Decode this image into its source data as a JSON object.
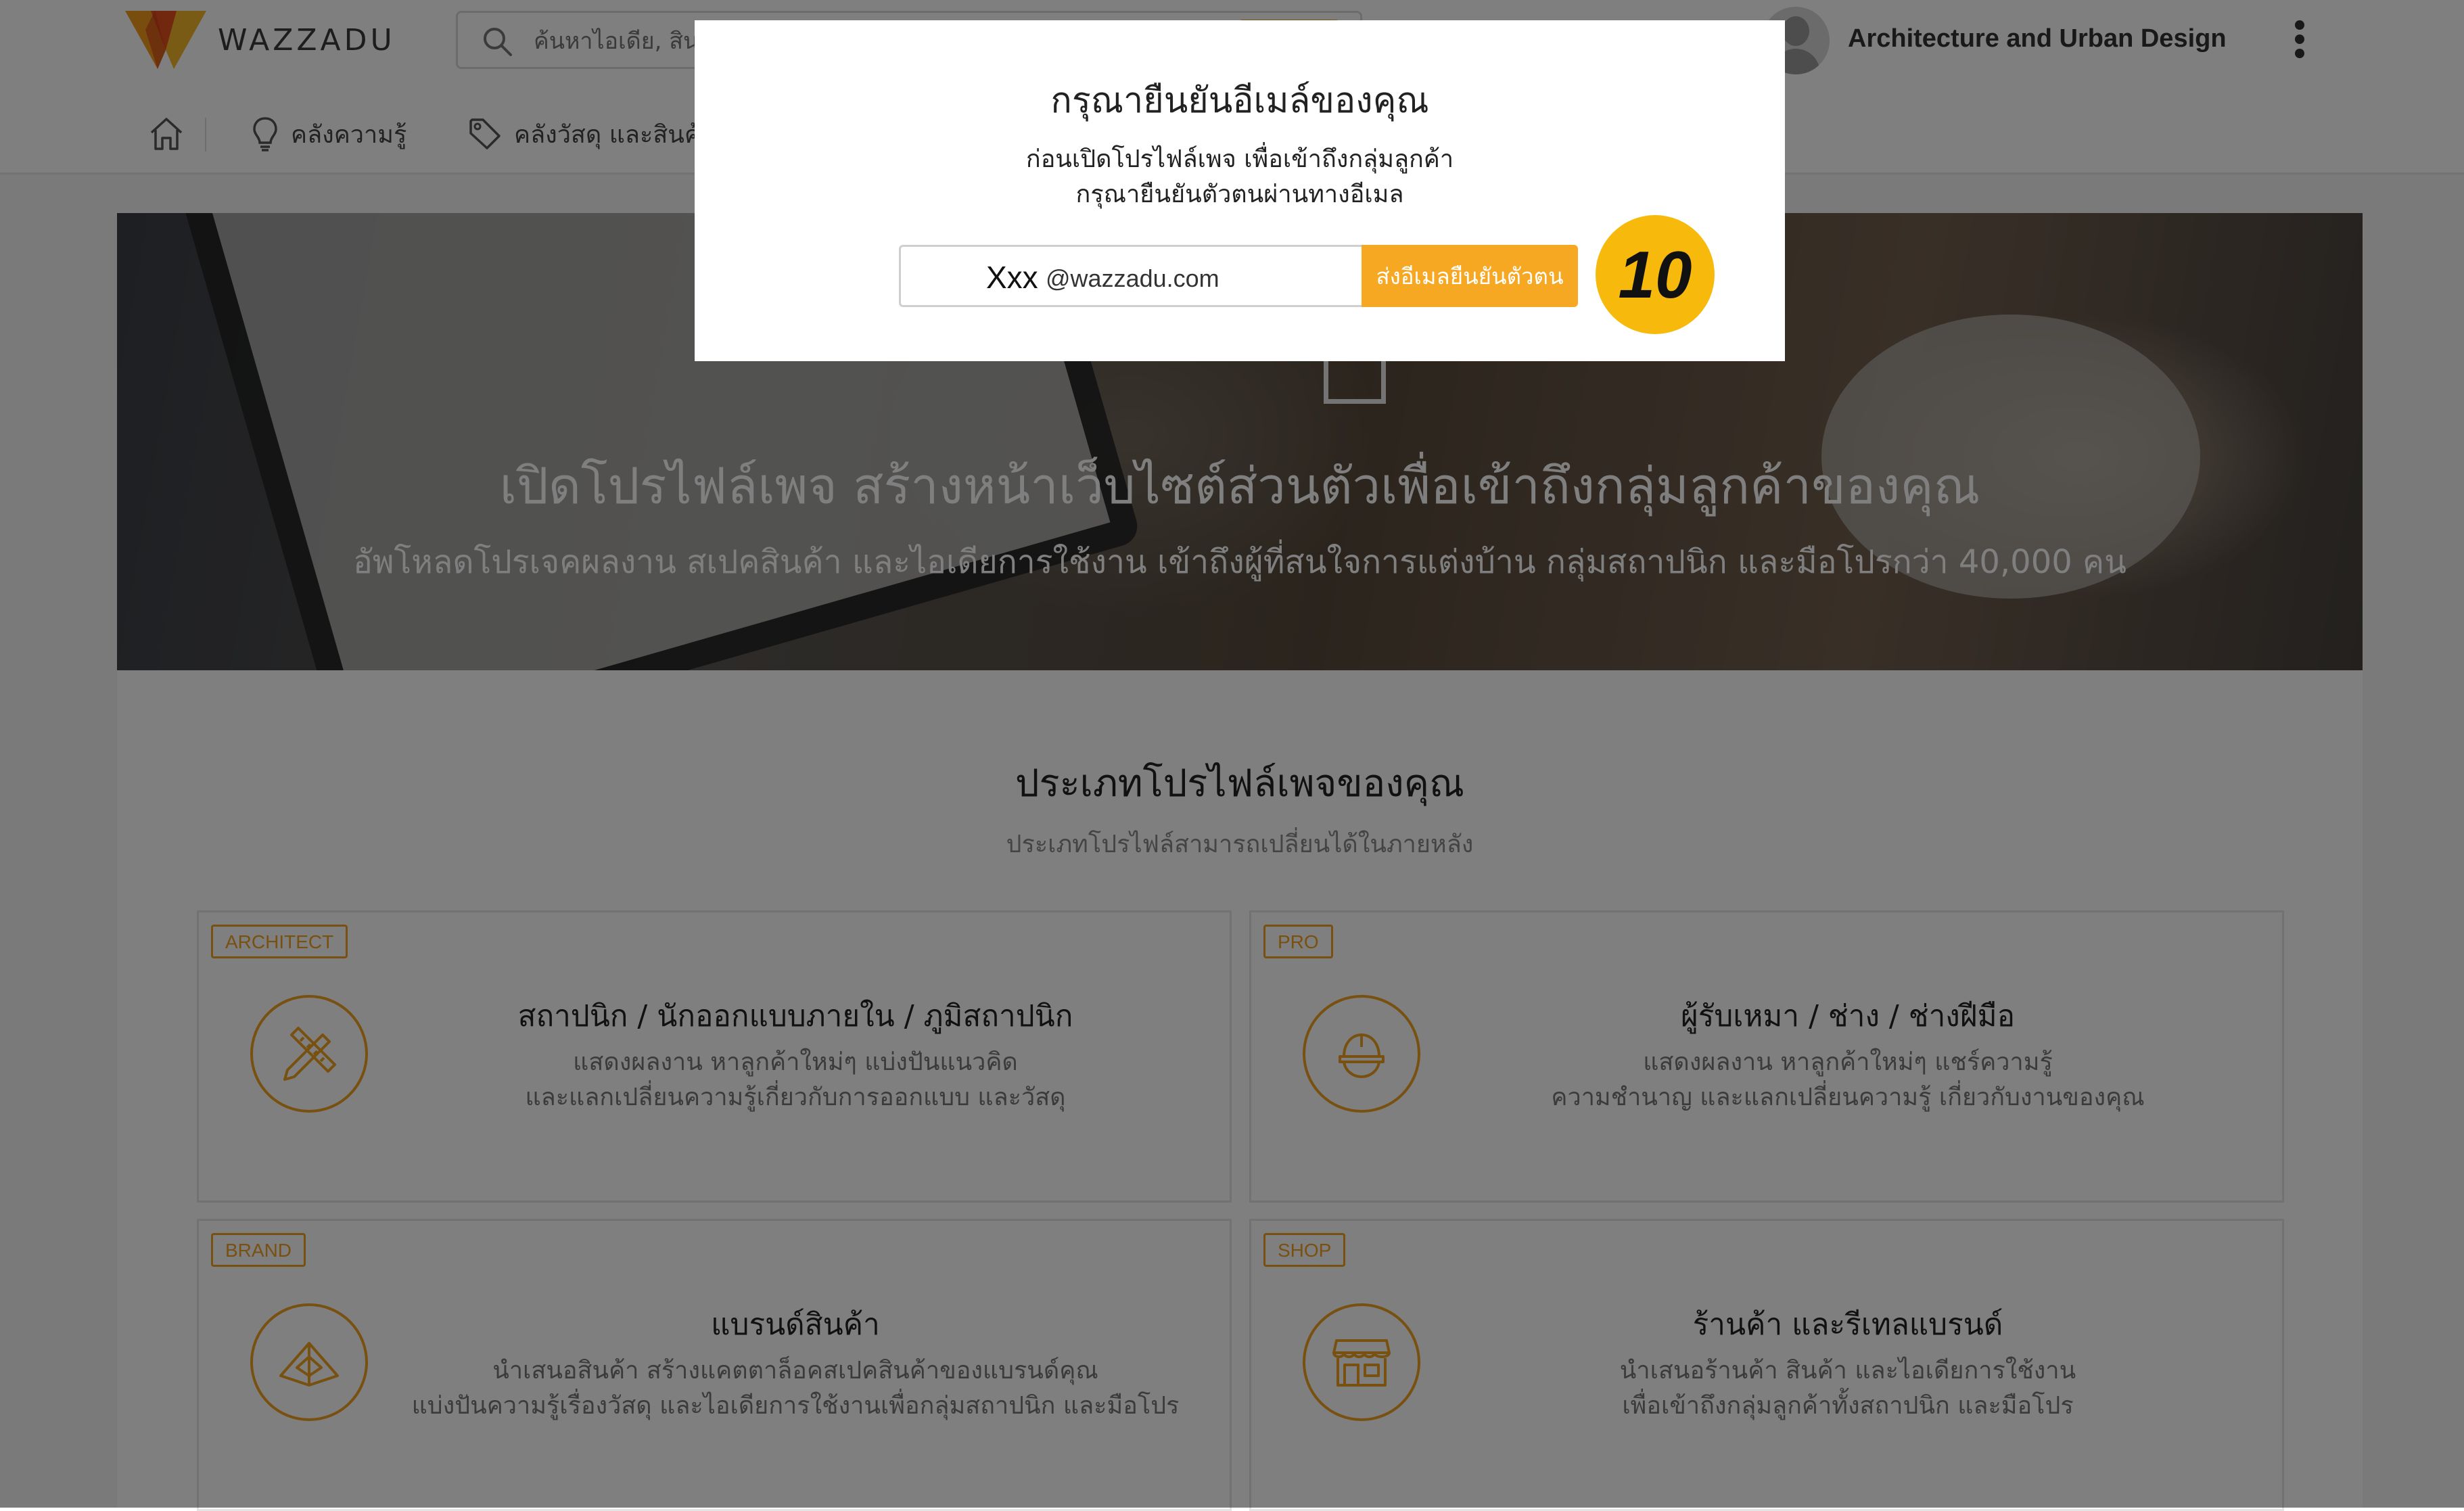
{
  "header": {
    "brand": "WAZZADU",
    "search_placeholder": "ค้นหาไอเดีย, สินค้า",
    "user_name": "Architecture and Urban Design"
  },
  "nav": {
    "items": [
      {
        "label": "คลังความรู้",
        "icon": "lightbulb-icon"
      },
      {
        "label": "คลังวัสดุ และสินค้า",
        "icon": "tag-icon"
      }
    ]
  },
  "hero": {
    "title": "เปิดโปรไฟล์เพจ สร้างหน้าเว็บไซต์ส่วนตัวเพื่อเข้าถึงกลุ่มลูกค้าของคุณ",
    "subtitle": "อัพโหลดโปรเจคผลงาน สเปคสินค้า และไอเดียการใช้งาน เข้าถึงผู้ที่สนใจการแต่งบ้าน กลุ่มสถาปนิก และมือโปรกว่า 40,000 คน"
  },
  "section": {
    "title": "ประเภทโปรไฟล์เพจของคุณ",
    "subtitle": "ประเภทโปรไฟล์สามารถเปลี่ยนได้ในภายหลัง"
  },
  "cards": [
    {
      "tag": "ARCHITECT",
      "title": "สถาปนิก / นักออกแบบภายใน / ภูมิสถาปนิก",
      "desc1": "แสดงผลงาน หาลูกค้าใหม่ๆ แบ่งปันแนวคิด",
      "desc2": "และแลกเปลี่ยนความรู้เกี่ยวกับการออกแบบ และวัสดุ",
      "icon": "pencil-ruler-icon"
    },
    {
      "tag": "PRO",
      "title": "ผู้รับเหมา / ช่าง / ช่างฝีมือ",
      "desc1": "แสดงผลงาน หาลูกค้าใหม่ๆ แชร์ความรู้",
      "desc2": "ความชำนาญ และแลกเปลี่ยนความรู้ เกี่ยวกับงานของคุณ",
      "icon": "hard-hat-icon"
    },
    {
      "tag": "BRAND",
      "title": "แบรนด์สินค้า",
      "desc1": "นำเสนอสินค้า สร้างแคตตาล็อคสเปคสินค้าของแบรนด์คุณ",
      "desc2": "แบ่งปันความรู้เรื่องวัสดุ และไอเดียการใช้งานเพื่อกลุ่มสถาปนิก และมือโปร",
      "icon": "tent-icon"
    },
    {
      "tag": "SHOP",
      "title": "ร้านค้า และรีเทลแบรนด์",
      "desc1": "นำเสนอร้านค้า สินค้า และไอเดียการใช้งาน",
      "desc2": "เพื่อเข้าถึงกลุ่มลูกค้าทั้งสถาปนิก และมือโปร",
      "icon": "storefront-icon"
    }
  ],
  "modal": {
    "title": "กรุณายืนยันอีเมล์ของคุณ",
    "line1": "ก่อนเปิดโปรไฟล์เพจ เพื่อเข้าถึงกลุ่มลูกค้า",
    "line2": "กรุณายืนยันตัวตนผ่านทางอีเมล",
    "email_user": "Xxx",
    "email_domain": "@wazzadu.com",
    "send_button": "ส่งอีเมลยืนยันตัวตน",
    "step_number": "10"
  },
  "colors": {
    "accent": "#f7a823",
    "badge": "#f7b90c",
    "overlay": "rgba(0,0,0,0.5)"
  }
}
